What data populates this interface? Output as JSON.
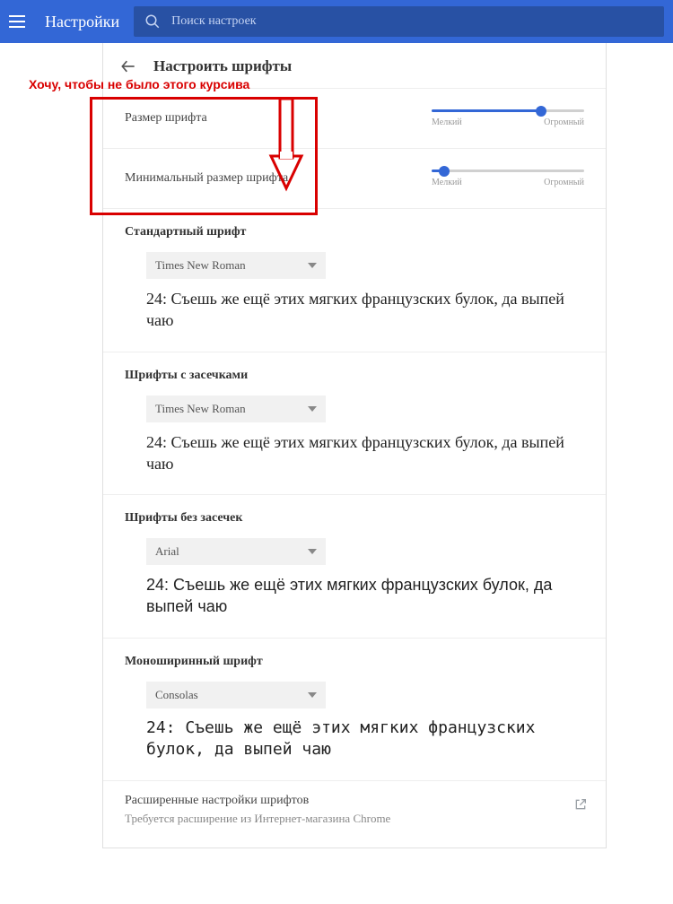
{
  "topbar": {
    "title": "Настройки",
    "search_placeholder": "Поиск настроек"
  },
  "annotation": {
    "text": "Хочу, чтобы не было этого курсива"
  },
  "page_title": "Настроить шрифты",
  "font_size": {
    "label": "Размер шрифта",
    "min_label": "Мелкий",
    "max_label": "Огромный",
    "percent": 72
  },
  "min_font_size": {
    "label": "Минимальный размер шрифта",
    "min_label": "Мелкий",
    "max_label": "Огромный",
    "percent": 8
  },
  "standard": {
    "title": "Стандартный шрифт",
    "value": "Times New Roman",
    "sample": "24: Съешь же ещё этих мягких французских булок, да выпей чаю"
  },
  "serif": {
    "title": "Шрифты с засечками",
    "value": "Times New Roman",
    "sample": "24: Съешь же ещё этих мягких французских булок, да выпей чаю"
  },
  "sans": {
    "title": "Шрифты без засечек",
    "value": "Arial",
    "sample": "24: Съешь же ещё этих мягких французских булок, да выпей чаю"
  },
  "mono": {
    "title": "Моноширинный шрифт",
    "value": "Consolas",
    "sample": "24: Съешь же ещё этих мягких французских булок, да выпей чаю"
  },
  "advanced": {
    "title": "Расширенные настройки шрифтов",
    "subtitle": "Требуется расширение из Интернет-магазина Chrome"
  }
}
